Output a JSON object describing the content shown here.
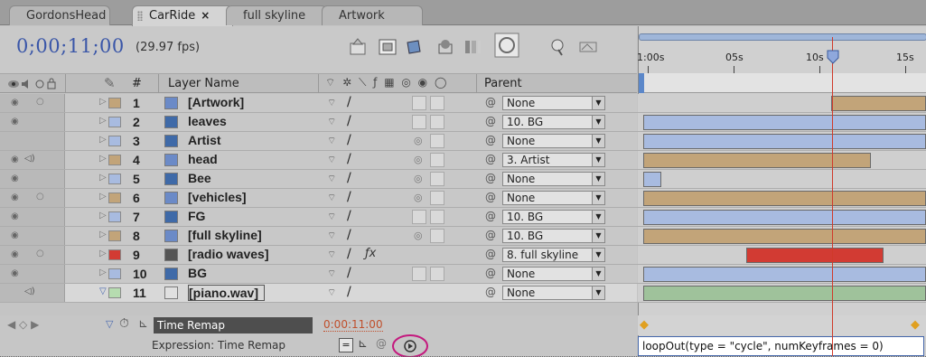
{
  "tabs": [
    {
      "label": "GordonsHead",
      "active": false
    },
    {
      "label": "CarRide",
      "active": true,
      "close": "×"
    },
    {
      "label": "full skyline",
      "active": false
    },
    {
      "label": "Artwork",
      "active": false
    }
  ],
  "header": {
    "timecode": "0;00;11;00",
    "fps": "(29.97 fps)"
  },
  "columns": {
    "number": "#",
    "layer_name": "Layer Name",
    "parent": "Parent"
  },
  "ruler": {
    "labels": [
      "1:00s",
      "05s",
      "10s",
      "15s"
    ]
  },
  "colors": {
    "tan": "#c2a479",
    "blue": "#a8bbe0",
    "red": "#d23b33",
    "green": "#9fc29b",
    "cti": "#d03a2a",
    "timecode": "#3a56a8"
  },
  "layers": [
    {
      "num": "1",
      "name": "[Artwork]",
      "icon": "composition-icon",
      "label_color": "#c2a479",
      "parent": "None"
    },
    {
      "num": "2",
      "name": "leaves",
      "icon": "psd-icon",
      "label_color": "#a8bbe0",
      "parent": "10. BG"
    },
    {
      "num": "3",
      "name": "Artist",
      "icon": "psd-icon",
      "label_color": "#a8bbe0",
      "parent": "None"
    },
    {
      "num": "4",
      "name": "head",
      "icon": "composition-icon",
      "label_color": "#c2a479",
      "parent": "3. Artist"
    },
    {
      "num": "5",
      "name": "Bee",
      "icon": "psd-icon",
      "label_color": "#a8bbe0",
      "parent": "None"
    },
    {
      "num": "6",
      "name": "[vehicles]",
      "icon": "composition-icon",
      "label_color": "#c2a479",
      "parent": "None"
    },
    {
      "num": "7",
      "name": "FG",
      "icon": "psd-icon",
      "label_color": "#a8bbe0",
      "parent": "10. BG"
    },
    {
      "num": "8",
      "name": "[full skyline]",
      "icon": "composition-icon",
      "label_color": "#c2a479",
      "parent": "10. BG"
    },
    {
      "num": "9",
      "name": "[radio waves]",
      "icon": "solid-icon",
      "label_color": "#d23b33",
      "parent": "8. full skyline"
    },
    {
      "num": "10",
      "name": "BG",
      "icon": "psd-icon",
      "label_color": "#a8bbe0",
      "parent": "None"
    },
    {
      "num": "11",
      "name": "[piano.wav]",
      "icon": "audio-icon",
      "label_color": "#b6dcb0",
      "parent": "None"
    }
  ],
  "time_remap": {
    "label": "Time Remap",
    "value": "0:00:11:00"
  },
  "expression": {
    "label": "Expression: Time Remap",
    "text": "loopOut(type = \"cycle\", numKeyframes = 0)"
  }
}
